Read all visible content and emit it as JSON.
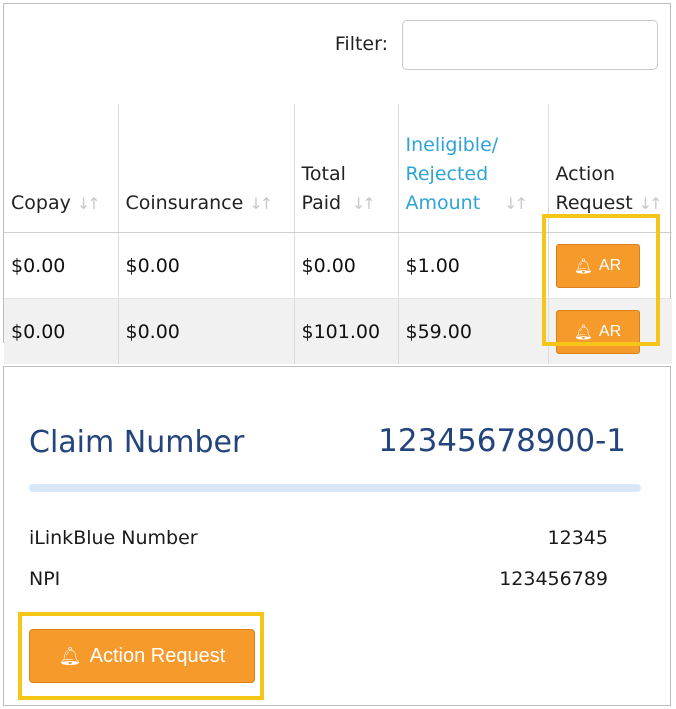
{
  "filter": {
    "label": "Filter:",
    "value": ""
  },
  "table": {
    "columns": [
      {
        "label": "Copay",
        "link": false
      },
      {
        "label": "Coinsurance",
        "link": false
      },
      {
        "label": "Total\nPaid",
        "link": false
      },
      {
        "label": "Ineligible/\nRejected\nAmount",
        "link": true
      },
      {
        "label": "Action\nRequest",
        "link": false
      }
    ],
    "rows": [
      {
        "copay": "$0.00",
        "coinsurance": "$0.00",
        "total_paid": "$0.00",
        "ineligible": "$1.00",
        "action_label": "AR"
      },
      {
        "copay": "$0.00",
        "coinsurance": "$0.00",
        "total_paid": "$101.00",
        "ineligible": "$59.00",
        "action_label": "AR"
      }
    ],
    "sort_icon": "sort-arrows-icon"
  },
  "claim_detail": {
    "title": "Claim Number",
    "number": "12345678900-1",
    "fields": [
      {
        "label": "iLinkBlue Number",
        "value": "12345"
      },
      {
        "label": "NPI",
        "value": "123456789"
      }
    ],
    "action_button_label": "Action Request",
    "bell_icon": "bell-icon"
  },
  "colors": {
    "accent_orange": "#f69a2c",
    "highlight_yellow": "#f5c518",
    "link_blue": "#2ea3d6",
    "title_navy": "#24457c"
  }
}
